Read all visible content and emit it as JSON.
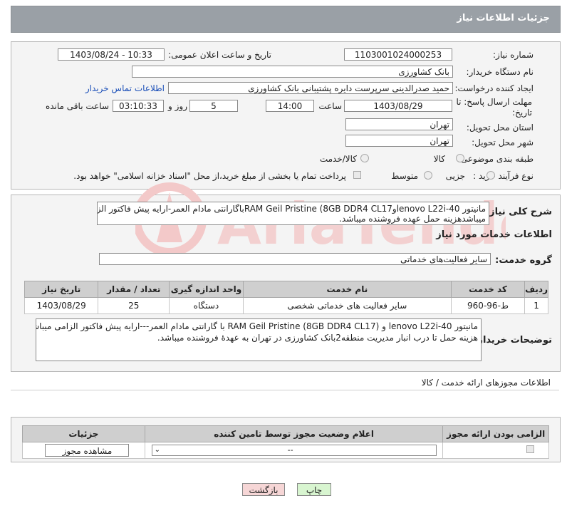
{
  "header": {
    "title": "جزئیات اطلاعات نیاز"
  },
  "form": {
    "need_number_label": "شماره نیاز:",
    "need_number": "1103001024000253",
    "announce_label": "تاریخ و ساعت اعلان عمومی:",
    "announce_value": "1403/08/24 - 10:33",
    "buyer_org_label": "نام دستگاه خریدار:",
    "buyer_org": "بانک کشاورزی",
    "creator_label": "ایجاد کننده درخواست:",
    "creator": "حمید صدرالدینی سرپرست دایره  پشتیبانی بانک کشاورزی",
    "contact_link": "اطلاعات تماس خریدار",
    "deadline_label_1": "مهلت ارسال پاسخ: تا",
    "deadline_label_2": "تاریخ:",
    "deadline_date": "1403/08/29",
    "time_label": "ساعت",
    "deadline_time": "14:00",
    "days_value": "5",
    "days_label": "روز و",
    "remaining_time": "03:10:33",
    "remaining_label": "ساعت باقی مانده",
    "province_label": "استان محل تحویل:",
    "province": "تهران",
    "city_label": "شهر محل تحویل:",
    "city": "تهران",
    "category_label": "طبقه بندی موضوعی:",
    "category_options": [
      "کالا",
      "کالا/خدمت"
    ],
    "process_label": "نوع فرآیند خرید :",
    "process_options": [
      "جزیی",
      "متوسط"
    ],
    "payment_note": "پرداخت تمام یا بخشی از مبلغ خرید،از محل \"اسناد خزانه اسلامی\" خواهد بود."
  },
  "summary": {
    "label": "شرح کلی نیاز:",
    "line1": "مانیتور lenovo L22i-40وRAM  Geil Pristine (8GB DDR4 CL17باگارانتی مادام العمر-ارایه پیش فاکتور الزامی",
    "line2": "میباشدهزینه حمل عهده فروشنده میباشد."
  },
  "services": {
    "section_title": "اطلاعات خدمات مورد نیاز",
    "group_label": "گروه خدمت:",
    "group_value": "سایر فعالیت‌های خدماتی",
    "columns": [
      "ردیف",
      "کد خدمت",
      "نام خدمت",
      "واحد اندازه گیری",
      "تعداد / مقدار",
      "تاریخ نیاز"
    ],
    "rows": [
      [
        "1",
        "ط-96-960",
        "سایر فعالیت های خدماتی شخصی",
        "دستگاه",
        "25",
        "1403/08/29"
      ]
    ]
  },
  "buyer_notes": {
    "label": "توضیحات خریدار:",
    "line1": "مانیتور lenovo L22i-40   و   RAM  Geil Pristine   (8GB DDR4 CL17) با گارانتی مادام العمر---ارایه پیش فاکتور الزامی میباشد-",
    "line2": "هزینه حمل تا درب انبار مدیریت منطقه2بانک کشاورزی در تهران به عهدۀ فروشنده میباشد."
  },
  "permits": {
    "section_title": "اطلاعات مجوزهای ارائه خدمت / کالا",
    "columns": [
      "الزامی بودن ارائه مجوز",
      "اعلام وضعیت مجوز توسط تامین کننده",
      "جزئیات"
    ],
    "select_value": "--",
    "view_button": "مشاهده مجوز"
  },
  "footer": {
    "print_button": "چاپ",
    "back_button": "بازگشت"
  },
  "watermark": {
    "text": "AriaTender.neT"
  },
  "colors": {
    "header_bg": "#9aa0a6",
    "panel_bg": "#f4f4f4",
    "link": "#1b4fb8",
    "back_btn_bg": "#f6d6d6",
    "print_btn_bg": "#d8f5d0"
  }
}
